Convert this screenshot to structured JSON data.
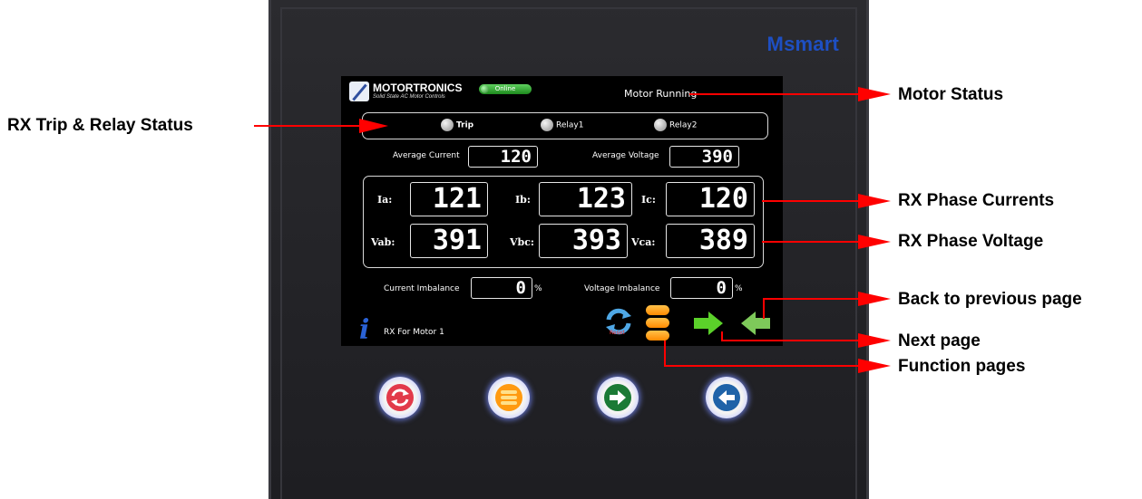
{
  "device": {
    "brand": "Msmart"
  },
  "screen": {
    "logo_title": "MOTORTRONICS",
    "logo_subtitle": "Solid State AC Motor Controls",
    "online_label": "Online",
    "motor_status": "Motor Running",
    "relays": [
      {
        "label": "Trip"
      },
      {
        "label": "Relay1"
      },
      {
        "label": "Relay2"
      }
    ],
    "average_current": {
      "label": "Average Current",
      "value": "120"
    },
    "average_voltage": {
      "label": "Average Voltage",
      "value": "390"
    },
    "phases": {
      "ia": {
        "label": "Ia:",
        "value": "121"
      },
      "ib": {
        "label": "Ib:",
        "value": "123"
      },
      "ic": {
        "label": "Ic:",
        "value": "120"
      },
      "vab": {
        "label": "Vab:",
        "value": "391"
      },
      "vbc": {
        "label": "Vbc:",
        "value": "393"
      },
      "vca": {
        "label": "Vca:",
        "value": "389"
      }
    },
    "current_imbalance": {
      "label": "Current Imbalance",
      "value": "0",
      "unit": "%"
    },
    "voltage_imbalance": {
      "label": "Voltage Imbalance",
      "value": "0",
      "unit": "%"
    },
    "footer_text": "RX For Motor 1",
    "reset_caption": "Reset"
  },
  "callouts": {
    "relay_status": "RX Trip & Relay Status",
    "motor_status": "Motor Status",
    "phase_currents": "RX Phase Currents",
    "phase_voltage": "RX Phase Voltage",
    "back": "Back to previous page",
    "next": "Next page",
    "function": "Function pages"
  },
  "colors": {
    "arrow": "#ff0000",
    "brand": "#1e4fc2",
    "info": "#2a62d6",
    "next_green": "#5bd12a",
    "func_orange": "#ff9a10"
  }
}
